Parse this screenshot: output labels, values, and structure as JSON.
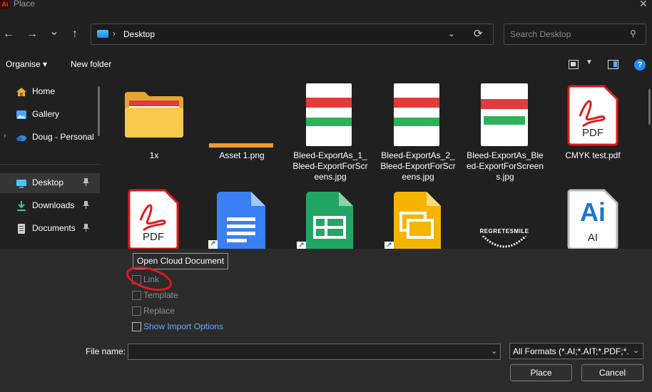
{
  "window": {
    "app_logo": "Ai",
    "title": "Place",
    "close": "✕"
  },
  "nav": {
    "back": "←",
    "forward": "→",
    "recent": "⌄",
    "up": "↑",
    "crumb_sep": "›",
    "breadcrumb": "Desktop",
    "addr_chevron": "⌄",
    "refresh": "⟳",
    "search_placeholder": "Search Desktop",
    "search_icon": "⚲"
  },
  "command_bar": {
    "organise": "Organise ▾",
    "new_folder": "New folder",
    "help": "?",
    "view_chevron": "▼"
  },
  "sidebar": {
    "items": [
      {
        "label": "Home",
        "icon": "home-icon",
        "color": "#e8b341"
      },
      {
        "label": "Gallery",
        "icon": "gallery-icon",
        "color": "#4fa3ff"
      },
      {
        "label": "Doug - Personal",
        "icon": "onedrive-icon",
        "color": "#2f8de4",
        "expand": "›"
      },
      {
        "label": "Desktop",
        "icon": "desktop-icon",
        "color": "#4fc3f7",
        "pin": "📌",
        "selected": true
      },
      {
        "label": "Downloads",
        "icon": "download-icon",
        "color": "#3cc98a",
        "pin": "📌"
      },
      {
        "label": "Documents",
        "icon": "documents-icon",
        "color": "#cfcfcf",
        "pin": "📌"
      }
    ]
  },
  "files": [
    {
      "name": "1x",
      "type": "folder"
    },
    {
      "name": "Asset 1.png",
      "type": "png"
    },
    {
      "name": "Bleed-ExportAs_1_Bleed-ExportForScreens.jpg",
      "type": "jpg"
    },
    {
      "name": "Bleed-ExportAs_2_Bleed-ExportForScreens.jpg",
      "type": "jpg"
    },
    {
      "name": "Bleed-ExportAs_Bleed-ExportForScreens.jpg",
      "type": "jpg"
    },
    {
      "name": "CMYK test.pdf",
      "type": "pdf",
      "badge": "PDF"
    },
    {
      "name": "",
      "type": "pdf",
      "badge": "PDF"
    },
    {
      "name": "",
      "type": "gdoc"
    },
    {
      "name": "",
      "type": "gsheet"
    },
    {
      "name": "",
      "type": "gslides"
    },
    {
      "name": "",
      "type": "image",
      "caption": "REGRETESMILE"
    },
    {
      "name": "",
      "type": "ai",
      "badge_big": "Ai",
      "badge_small": "AI"
    }
  ],
  "options": {
    "tooltip": "Open Cloud Document",
    "link": "Link",
    "template": "Template",
    "replace": "Replace",
    "show_import": "Show Import Options"
  },
  "footer": {
    "file_name_label": "File name:",
    "file_name_value": "",
    "filter": "All Formats (*.AI;*.AIT;*.PDF;*.D",
    "place": "Place",
    "cancel": "Cancel"
  },
  "colors": {
    "accent": "#1f8bff",
    "annotation": "#e01b1b"
  }
}
